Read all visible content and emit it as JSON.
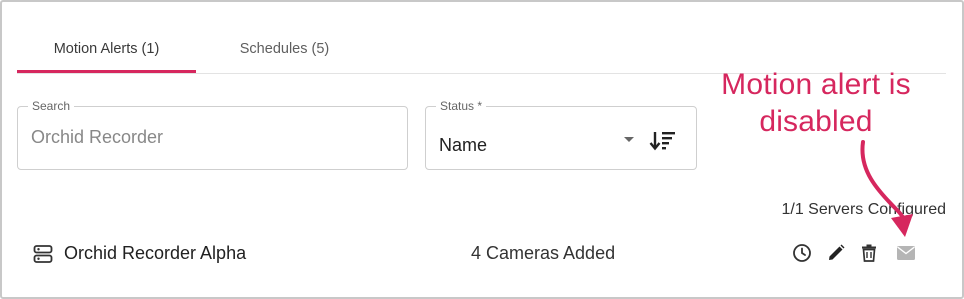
{
  "tabs": [
    {
      "label": "Motion Alerts (1)",
      "active": true
    },
    {
      "label": "Schedules (5)",
      "active": false
    }
  ],
  "search": {
    "label": "Search",
    "placeholder": "Orchid Recorder",
    "value": ""
  },
  "status": {
    "label": "Status *",
    "value": "Name",
    "sort_icon": "sort-descending-icon"
  },
  "annotation": {
    "line1": "Motion alert is",
    "line2": "disabled"
  },
  "summary": {
    "servers_text": "1/1 Servers Configured"
  },
  "rows": [
    {
      "icon": "server-icon",
      "name": "Orchid Recorder Alpha",
      "cameras": "4 Cameras Added",
      "actions": [
        "clock-icon",
        "edit-pencil-icon",
        "delete-trash-icon",
        "mail-icon"
      ]
    }
  ],
  "colors": {
    "accent": "#d6275e",
    "disabled_icon": "#b5b5b5",
    "icon": "#333333"
  }
}
